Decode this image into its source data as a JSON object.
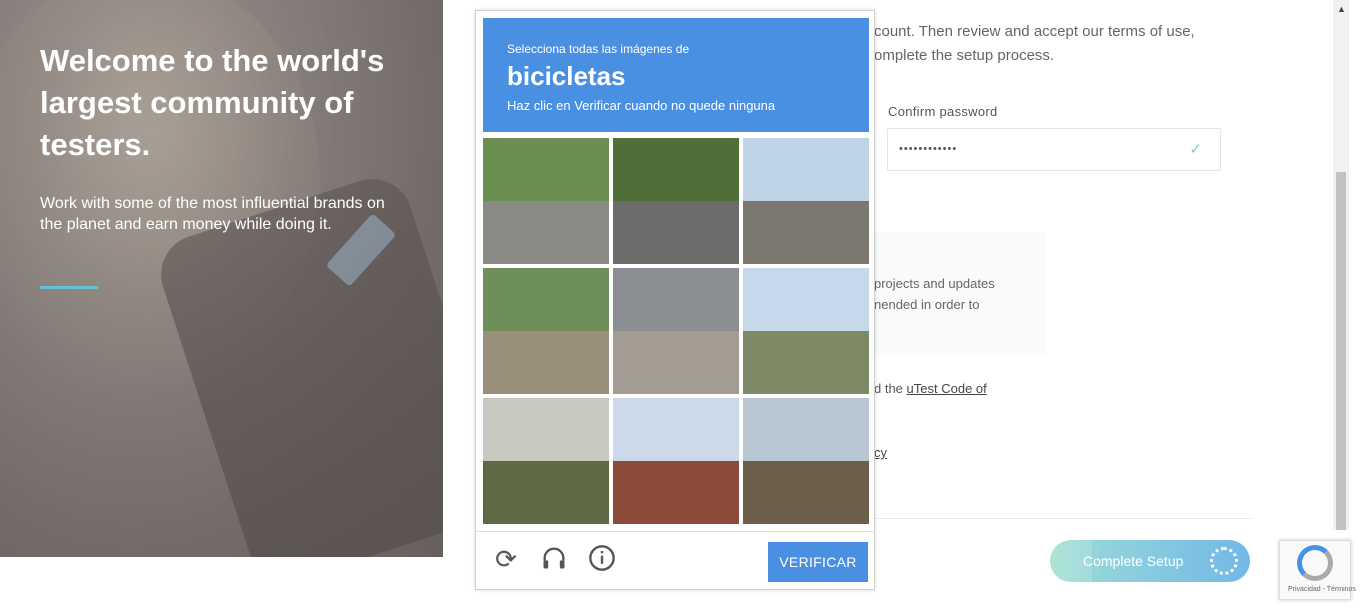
{
  "hero": {
    "title": "Welcome to the world's largest community of testers.",
    "subtitle": "Work with some of the most influential brands on the planet and earn money while doing it."
  },
  "form": {
    "intro_line1": "count. Then review and accept our terms of use,",
    "intro_line2": "omplete the setup process.",
    "confirm_password_label": "Confirm password",
    "confirm_password_value": "••••••••••••",
    "info_line1": "projects and updates",
    "info_line2": "nended in order to",
    "code_prefix": "d the",
    "code_link": "uTest Code of",
    "policy_fragment": "cy",
    "complete_button": "Complete Setup"
  },
  "captcha": {
    "instruction": "Selecciona todas las imágenes de",
    "target": "bicicletas",
    "hint": "Haz clic en Verificar cuando no quede ninguna",
    "verify_label": "VERIFICAR",
    "tiles": [
      {
        "sky": "#6a8f4e",
        "ground": "#8a8a85"
      },
      {
        "sky": "#4f6e38",
        "ground": "#6c6c6a"
      },
      {
        "sky": "#bfd3e6",
        "ground": "#7b7870"
      },
      {
        "sky": "#6f8f5a",
        "ground": "#9a8f7a"
      },
      {
        "sky": "#8a8d91",
        "ground": "#a29c92"
      },
      {
        "sky": "#c6d9ea",
        "ground": "#7e8a66"
      },
      {
        "sky": "#c7c8c0",
        "ground": "#5d6a45"
      },
      {
        "sky": "#cbd9e8",
        "ground": "#8b4b3a"
      },
      {
        "sky": "#b9c6d4",
        "ground": "#6e5e4c"
      }
    ]
  },
  "recaptcha_badge": "Privacidad - Términos",
  "colors": {
    "accent_blue": "#4a90e2",
    "hero_rule": "#62c3d3"
  }
}
